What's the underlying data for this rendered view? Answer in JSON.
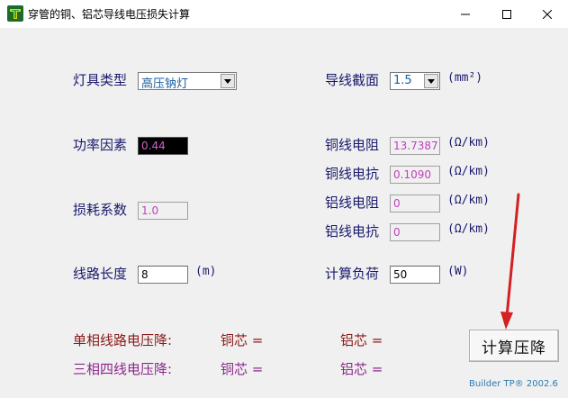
{
  "window": {
    "title": "穿管的铜、铝芯导线电压损失计算"
  },
  "form": {
    "lamp_type_label": "灯具类型",
    "lamp_type_value": "高压钠灯",
    "wire_section_label": "导线截面",
    "wire_section_value": "1.5",
    "wire_section_unit": "(mm²)",
    "power_factor_label": "功率因素",
    "power_factor_value": "0.44",
    "cu_resistance_label": "铜线电阻",
    "cu_resistance_value": "13.7387",
    "cu_resistance_unit": "(Ω/km)",
    "cu_reactance_label": "铜线电抗",
    "cu_reactance_value": "0.1090",
    "cu_reactance_unit": "(Ω/km)",
    "loss_coef_label": "损耗系数",
    "loss_coef_value": "1.0",
    "al_resistance_label": "铝线电阻",
    "al_resistance_value": "0",
    "al_resistance_unit": "(Ω/km)",
    "al_reactance_label": "铝线电抗",
    "al_reactance_value": "0",
    "al_reactance_unit": "(Ω/km)",
    "line_length_label": "线路长度",
    "line_length_value": "8",
    "line_length_unit": "(m)",
    "load_label": "计算负荷",
    "load_value": "50",
    "load_unit": "(W)"
  },
  "results": {
    "single_phase_label": "单相线路电压降:",
    "three_phase_label": "三相四线电压降:",
    "copper_label": "铜芯 =",
    "aluminum_label": "铝芯 ="
  },
  "buttons": {
    "calculate": "计算压降"
  },
  "footer": {
    "text": "Builder TP® 2002.6"
  },
  "colors": {
    "label_blue": "#1a1a6e",
    "single_phase_red": "#8b1a1a",
    "three_phase_purple": "#8b2a8b",
    "readonly_magenta": "#c040c0",
    "annotation_arrow": "#d42020"
  }
}
